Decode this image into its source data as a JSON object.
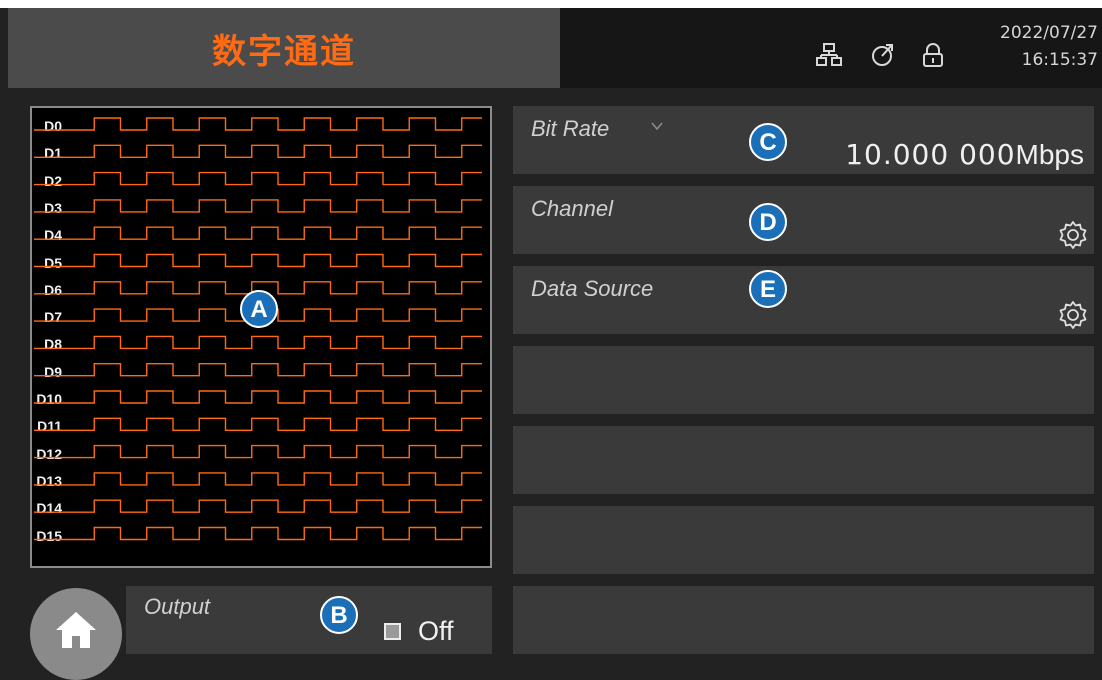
{
  "header": {
    "title": "数字通道",
    "date": "2022/07/27",
    "time": "16:15:37",
    "icons": [
      "network-icon",
      "timer-icon",
      "lock-icon"
    ]
  },
  "waveform": {
    "channels": [
      "D0",
      "D1",
      "D2",
      "D3",
      "D4",
      "D5",
      "D6",
      "D7",
      "D8",
      "D9",
      "D10",
      "D11",
      "D12",
      "D13",
      "D14",
      "D15"
    ],
    "trace_color": "#ff6a13"
  },
  "output": {
    "label": "Output",
    "value": "Off"
  },
  "settings": {
    "bit_rate": {
      "label": "Bit Rate",
      "value": "10.000 000",
      "unit": "Mbps"
    },
    "channel": {
      "label": "Channel"
    },
    "data_source": {
      "label": "Data Source"
    }
  },
  "markers": [
    "A",
    "B",
    "C",
    "D",
    "E"
  ],
  "colors": {
    "accent": "#ff6a13",
    "marker": "#1a6fb8",
    "card": "#3a3a3a",
    "background": "#222222"
  }
}
